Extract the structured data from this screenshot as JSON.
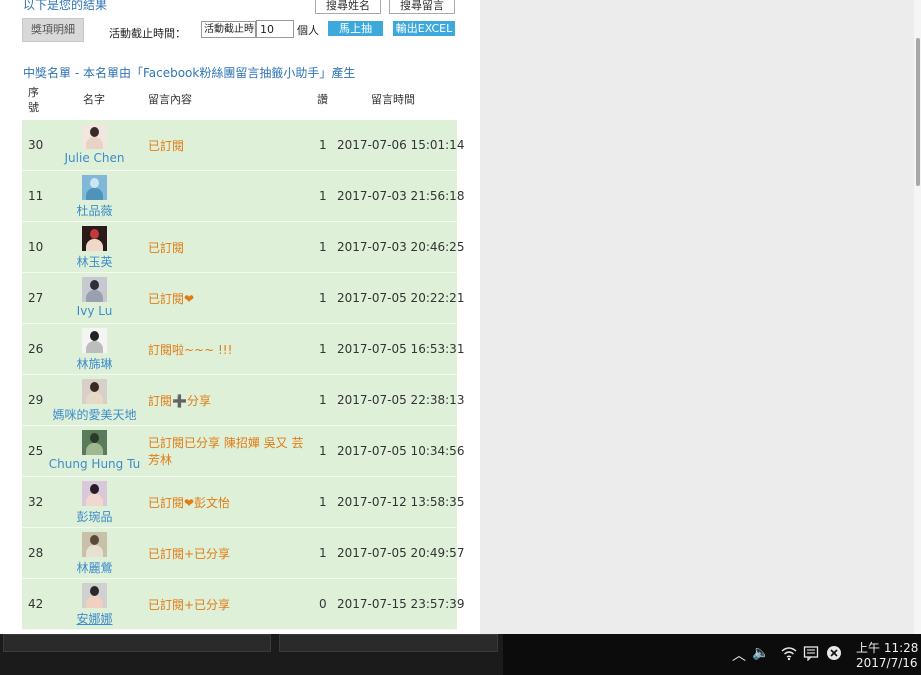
{
  "header": {
    "results_text": "以下是您的結果",
    "search_name_label": "搜尋姓名",
    "search_message_label": "搜尋留言"
  },
  "controls": {
    "prize_detail_label": "獎項明細",
    "deadline_label": "活動截止時間：",
    "deadline_select_value": "活動截止時間",
    "count_value": "10",
    "count_unit": "個人",
    "draw_now_label": "馬上抽",
    "export_excel_label": "輸出EXCEL"
  },
  "winners": {
    "title": "中獎名單 - 本名單由「Facebook粉絲團留言抽籤小助手」產生",
    "columns": {
      "no": "序號",
      "name": "名字",
      "message": "留言內容",
      "likes": "讚",
      "time": "留言時間"
    },
    "rows": [
      {
        "no": "30",
        "name": "Julie Chen",
        "message": "已訂閱",
        "likes": "1",
        "time": "2017-07-06 15:01:14",
        "avatar_colors": [
          "#f2e6e0",
          "#3a2a24",
          "#e9d3c6"
        ]
      },
      {
        "no": "11",
        "name": "杜品薇",
        "message": "",
        "likes": "1",
        "time": "2017-07-03 21:56:18",
        "avatar_colors": [
          "#7fb8d8",
          "#cfe6f2",
          "#4f93bd"
        ]
      },
      {
        "no": "10",
        "name": "林玉英",
        "message": "已訂閱",
        "likes": "1",
        "time": "2017-07-03 20:46:25",
        "avatar_colors": [
          "#2a1a1a",
          "#c23a3a",
          "#f0d8c8"
        ]
      },
      {
        "no": "27",
        "name": "Ivy Lu",
        "message": "已訂閱❤",
        "likes": "1",
        "time": "2017-07-05 20:22:21",
        "avatar_colors": [
          "#c8c8d0",
          "#2f2f3a",
          "#9aa0b0"
        ]
      },
      {
        "no": "26",
        "name": "林旆琳",
        "message": "訂閱啦~~~ !!!",
        "likes": "1",
        "time": "2017-07-05 16:53:31",
        "avatar_colors": [
          "#f4f4f4",
          "#222222",
          "#bdbdbd"
        ]
      },
      {
        "no": "29",
        "name": "媽咪的愛美天地",
        "message": "訂閱➕分享",
        "likes": "1",
        "time": "2017-07-05 22:38:13",
        "avatar_colors": [
          "#d8d0c8",
          "#3a2a22",
          "#e8d8c8"
        ]
      },
      {
        "no": "25",
        "name": "Chung Hung Tu",
        "message": "已訂閱已分享 陳招嬋 吳又 芸芳林",
        "likes": "1",
        "time": "2017-07-05 10:34:56",
        "avatar_colors": [
          "#5a7a5a",
          "#2a3a2a",
          "#a0b890"
        ]
      },
      {
        "no": "32",
        "name": "彭琬品",
        "message": "已訂閱❤彭文怡",
        "likes": "1",
        "time": "2017-07-12 13:58:35",
        "avatar_colors": [
          "#d8c8d8",
          "#2a1a2a",
          "#f0d8d0"
        ]
      },
      {
        "no": "28",
        "name": "林麗鶯",
        "message": "已訂閱+已分享",
        "likes": "1",
        "time": "2017-07-05 20:49:57",
        "avatar_colors": [
          "#c8c0a8",
          "#5a4a3a",
          "#e8e0d0"
        ]
      },
      {
        "no": "42",
        "name": "安娜娜",
        "message": "已訂閱+已分享",
        "likes": "0",
        "time": "2017-07-15 23:57:39",
        "avatar_colors": [
          "#d0d0d0",
          "#2a2a2a",
          "#f0d0c0"
        ]
      }
    ]
  },
  "taskbar": {
    "clock_time": "上午 11:28",
    "clock_date": "2017/7/16",
    "icons": [
      "chevron-up-icon",
      "volume-icon",
      "wifi-icon",
      "action-center-icon",
      "close-circle-icon"
    ]
  }
}
